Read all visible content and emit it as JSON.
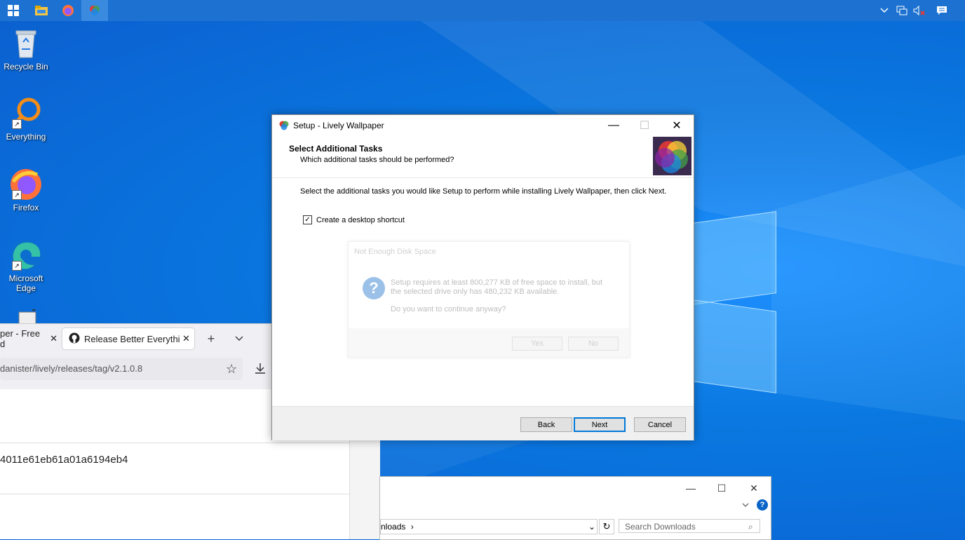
{
  "desktop": {
    "icons": [
      {
        "label": "Recycle Bin"
      },
      {
        "label": "Everything"
      },
      {
        "label": "Firefox"
      },
      {
        "label": "Microsoft Edge"
      }
    ]
  },
  "taskbar": {
    "items": [
      "start-icon",
      "file-explorer-icon",
      "firefox-icon",
      "lively-wallpaper-icon"
    ],
    "tray": [
      "chevron-up-icon",
      "network-icon",
      "volume-muted-icon",
      "notifications-icon"
    ]
  },
  "browser": {
    "tab1_label": "per - Free d",
    "tab2_label": "Release Better Everything",
    "new_tab_symbol": "+",
    "url": "danister/lively/releases/tag/v2.1.0.8",
    "hash_text": "4011e61eb61a01a6194eb4"
  },
  "explorer": {
    "breadcrumb": "nloads",
    "search_placeholder": "Search Downloads"
  },
  "setup": {
    "title": "Setup - Lively Wallpaper",
    "header_title": "Select Additional Tasks",
    "header_subtitle": "Which additional tasks should be performed?",
    "instruction": "Select the additional tasks you would like Setup to perform while installing Lively Wallpaper, then click Next.",
    "checkbox_label": "Create a desktop shortcut",
    "checkbox_checked": true,
    "back_label": "Back",
    "next_label": "Next",
    "cancel_label": "Cancel"
  },
  "msgbox": {
    "title": "Not Enough Disk Space",
    "line1": "Setup requires at least 800,277 KB of free space to install, but",
    "line2": "the selected drive only has 480,232 KB available.",
    "question": "Do you want to continue anyway?",
    "yes_label": "Yes",
    "no_label": "No"
  },
  "colors": {
    "desktop": "#0a78e0",
    "taskbar": "#1d72d1",
    "default_button_border": "#0078d7"
  }
}
